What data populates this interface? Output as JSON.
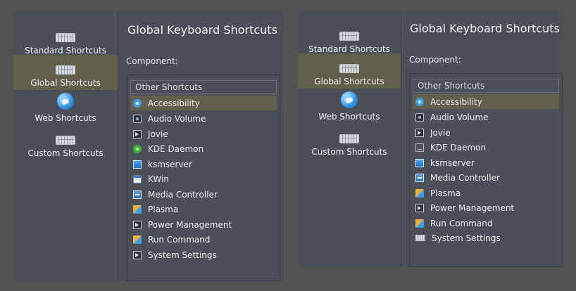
{
  "left": {
    "sidebar": [
      {
        "label": "Standard Shortcuts",
        "icon": "keyboard-icon"
      },
      {
        "label": "Global Shortcuts",
        "icon": "keyboard-icon",
        "selected": true
      },
      {
        "label": "Web Shortcuts",
        "icon": "globe-icon"
      },
      {
        "label": "Custom Shortcuts",
        "icon": "keyboard-icon"
      }
    ],
    "title": "Global Keyboard Shortcuts",
    "component_label": "Component:",
    "list_header": "Other Shortcuts",
    "items": [
      {
        "label": "Accessibility",
        "icon": "accessibility-icon",
        "selected": true
      },
      {
        "label": "Audio Volume",
        "icon": "audio-volume-icon"
      },
      {
        "label": "Jovie",
        "icon": "application-icon"
      },
      {
        "label": "KDE Daemon",
        "icon": "kde-daemon-icon"
      },
      {
        "label": "ksmserver",
        "icon": "monitor-icon"
      },
      {
        "label": "KWin",
        "icon": "window-icon"
      },
      {
        "label": "Media Controller",
        "icon": "media-controller-icon"
      },
      {
        "label": "Plasma",
        "icon": "plasma-icon"
      },
      {
        "label": "Power Management",
        "icon": "application-icon"
      },
      {
        "label": "Run Command",
        "icon": "run-command-icon"
      },
      {
        "label": "System Settings",
        "icon": "application-icon"
      }
    ]
  },
  "right": {
    "sidebar": [
      {
        "label": "Standard Shortcuts",
        "icon": "keyboard-icon"
      },
      {
        "label": "Global Shortcuts",
        "icon": "keyboard-icon",
        "selected": true
      },
      {
        "label": "Web Shortcuts",
        "icon": "globe-icon"
      },
      {
        "label": "Custom Shortcuts",
        "icon": "keyboard-icon"
      }
    ],
    "title": "Global Keyboard Shortcuts",
    "component_label": "Component:",
    "list_header": "Other Shortcuts",
    "items": [
      {
        "label": "Accessibility",
        "icon": "accessibility-icon",
        "selected": true
      },
      {
        "label": "Audio Volume",
        "icon": "audio-volume-icon"
      },
      {
        "label": "Jovie",
        "icon": "application-icon"
      },
      {
        "label": "KDE Daemon",
        "icon": "kde-daemon-icon"
      },
      {
        "label": "ksmserver",
        "icon": "monitor-icon"
      },
      {
        "label": "Media Controller",
        "icon": "media-controller-icon"
      },
      {
        "label": "Plasma",
        "icon": "plasma-icon"
      },
      {
        "label": "Power Management",
        "icon": "application-icon"
      },
      {
        "label": "Run Command",
        "icon": "run-command-icon"
      },
      {
        "label": "System Settings",
        "icon": "keyboard-icon"
      }
    ]
  },
  "colors": {
    "background": "#535353",
    "panel": "#4b5058",
    "selection": "#61604c"
  }
}
